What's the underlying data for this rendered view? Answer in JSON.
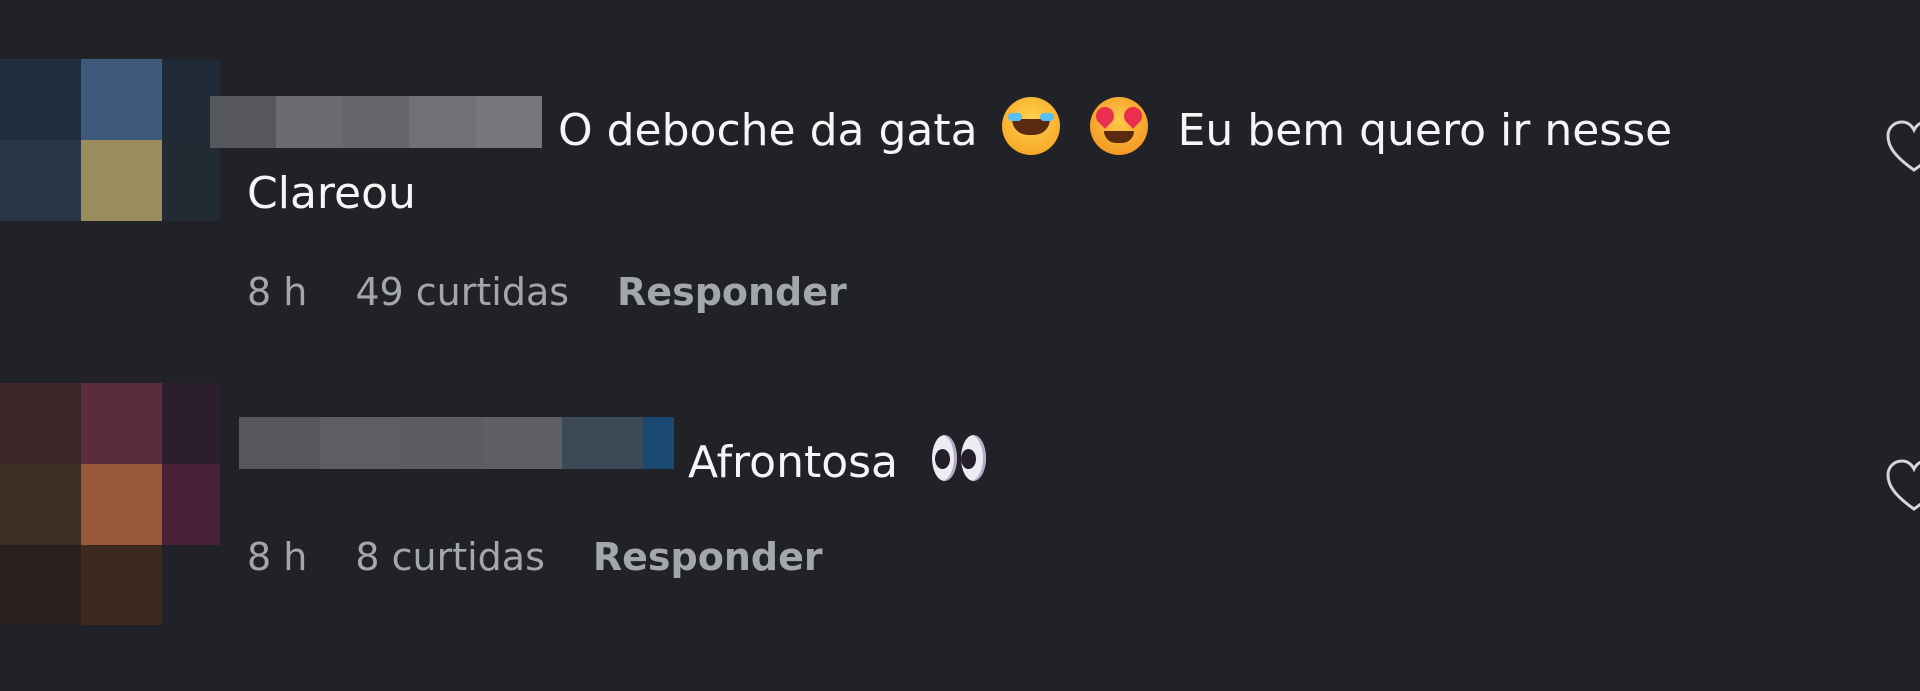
{
  "comments": [
    {
      "text_line1": "O deboche da gata",
      "text_line1_tail": "Eu bem quero ir nesse",
      "text_line2": "Clareou",
      "emojis": [
        "joy-icon",
        "heart-eyes-icon"
      ],
      "time": "8 h",
      "likes": "49 curtidas",
      "reply_label": "Responder"
    },
    {
      "text_line1": "Afrontosa",
      "emojis": [
        "eyes-icon"
      ],
      "time": "8 h",
      "likes": "8 curtidas",
      "reply_label": "Responder"
    }
  ],
  "colors": {
    "background": "#212227",
    "text": "#f5f5f5",
    "meta_text": "#a3a6ab"
  }
}
